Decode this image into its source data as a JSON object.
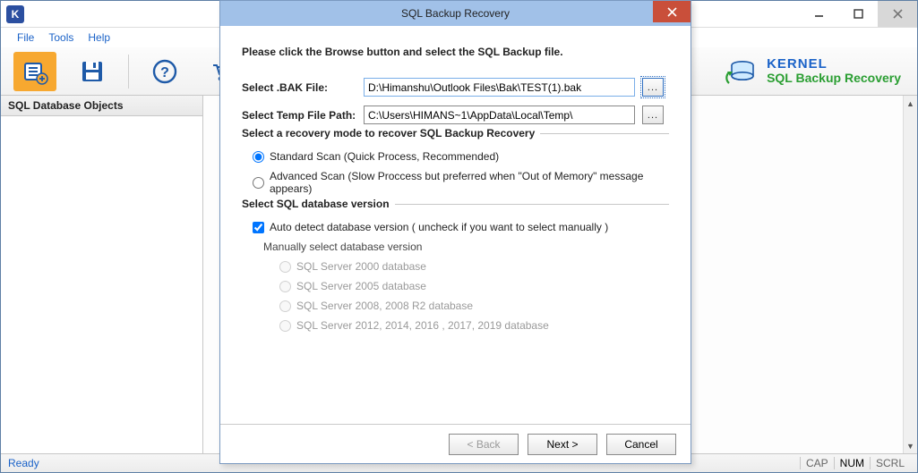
{
  "app": {
    "icon_letter": "K",
    "menu": {
      "file": "File",
      "tools": "Tools",
      "help": "Help"
    },
    "brand": {
      "name": "KERNEL",
      "product": "SQL Backup Recovery"
    },
    "sidebar": {
      "title": "SQL Database Objects"
    },
    "status": {
      "ready": "Ready",
      "cap": "CAP",
      "num": "NUM",
      "scrl": "SCRL"
    }
  },
  "dialog": {
    "title": "SQL Backup Recovery",
    "instruction": "Please click the Browse button and select the SQL Backup file.",
    "bak_label": "Select .BAK File:",
    "bak_value": "D:\\Himanshu\\Outlook Files\\Bak\\TEST(1).bak",
    "temp_label": "Select Temp File Path:",
    "temp_value": "C:\\Users\\HIMANS~1\\AppData\\Local\\Temp\\",
    "recovery_mode": {
      "legend": "Select a recovery mode to recover SQL Backup Recovery",
      "standard": "Standard Scan (Quick Process, Recommended)",
      "advanced": "Advanced Scan (Slow Proccess but preferred when \"Out of Memory\" message appears)"
    },
    "dbversion": {
      "legend": "Select SQL database version",
      "auto": "Auto detect database version ( uncheck if you want to select manually )",
      "manual_heading": "Manually select database version",
      "v2000": "SQL Server 2000 database",
      "v2005": "SQL Server 2005 database",
      "v2008": "SQL Server 2008, 2008 R2 database",
      "v2012": "SQL Server 2012, 2014, 2016 , 2017, 2019 database"
    },
    "buttons": {
      "back": "< Back",
      "next": "Next >",
      "cancel": "Cancel"
    }
  }
}
